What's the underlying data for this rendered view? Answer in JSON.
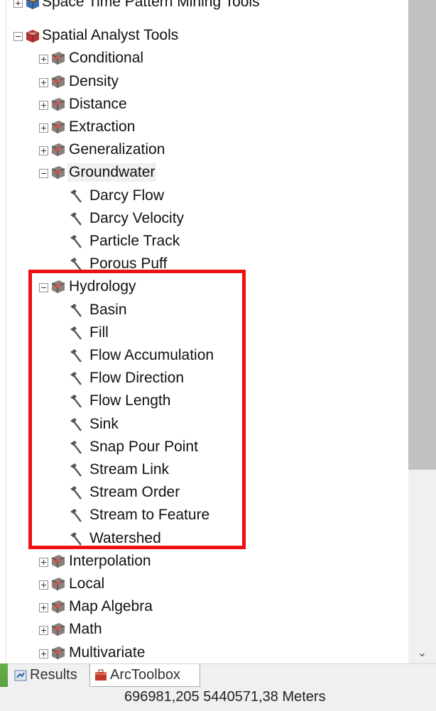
{
  "tree": {
    "items": [
      {
        "label": "Space Time Pattern Mining Tools",
        "level": 0,
        "kind": "toolbox",
        "expander": "plus",
        "colors": [
          "#3b6fb5",
          "#e08a2c"
        ]
      },
      {
        "label": "Spatial Analyst Tools",
        "level": 0,
        "kind": "toolbox",
        "expander": "minus",
        "colors": [
          "#b8322e",
          "#e5a39a"
        ]
      },
      {
        "label": "Conditional",
        "level": 1,
        "kind": "toolset",
        "expander": "plus"
      },
      {
        "label": "Density",
        "level": 1,
        "kind": "toolset",
        "expander": "plus"
      },
      {
        "label": "Distance",
        "level": 1,
        "kind": "toolset",
        "expander": "plus"
      },
      {
        "label": "Extraction",
        "level": 1,
        "kind": "toolset",
        "expander": "plus"
      },
      {
        "label": "Generalization",
        "level": 1,
        "kind": "toolset",
        "expander": "plus"
      },
      {
        "label": "Groundwater",
        "level": 1,
        "kind": "toolset",
        "expander": "minus",
        "selected": true
      },
      {
        "label": "Darcy Flow",
        "level": 2,
        "kind": "tool"
      },
      {
        "label": "Darcy Velocity",
        "level": 2,
        "kind": "tool"
      },
      {
        "label": "Particle Track",
        "level": 2,
        "kind": "tool"
      },
      {
        "label": "Porous Puff",
        "level": 2,
        "kind": "tool"
      },
      {
        "label": "Hydrology",
        "level": 1,
        "kind": "toolset",
        "expander": "minus"
      },
      {
        "label": "Basin",
        "level": 2,
        "kind": "tool"
      },
      {
        "label": "Fill",
        "level": 2,
        "kind": "tool"
      },
      {
        "label": "Flow Accumulation",
        "level": 2,
        "kind": "tool"
      },
      {
        "label": "Flow Direction",
        "level": 2,
        "kind": "tool"
      },
      {
        "label": "Flow Length",
        "level": 2,
        "kind": "tool"
      },
      {
        "label": "Sink",
        "level": 2,
        "kind": "tool"
      },
      {
        "label": "Snap Pour Point",
        "level": 2,
        "kind": "tool"
      },
      {
        "label": "Stream Link",
        "level": 2,
        "kind": "tool"
      },
      {
        "label": "Stream Order",
        "level": 2,
        "kind": "tool"
      },
      {
        "label": "Stream to Feature",
        "level": 2,
        "kind": "tool"
      },
      {
        "label": "Watershed",
        "level": 2,
        "kind": "tool"
      },
      {
        "label": "Interpolation",
        "level": 1,
        "kind": "toolset",
        "expander": "plus"
      },
      {
        "label": "Local",
        "level": 1,
        "kind": "toolset",
        "expander": "plus"
      },
      {
        "label": "Map Algebra",
        "level": 1,
        "kind": "toolset",
        "expander": "plus"
      },
      {
        "label": "Math",
        "level": 1,
        "kind": "toolset",
        "expander": "plus"
      },
      {
        "label": "Multivariate",
        "level": 1,
        "kind": "toolset",
        "expander": "plus"
      }
    ]
  },
  "highlight": {
    "color": "#ee1111",
    "group": "Hydrology"
  },
  "tabs": {
    "results": {
      "label": "Results",
      "icon": "results-icon"
    },
    "arctoolbox": {
      "label": "ArcToolbox",
      "icon": "arctoolbox-icon"
    }
  },
  "status": {
    "coordinates": "696981,205  5440571,38 Meters"
  },
  "scrollbar": {
    "down_arrow": "chevron-down-icon"
  }
}
